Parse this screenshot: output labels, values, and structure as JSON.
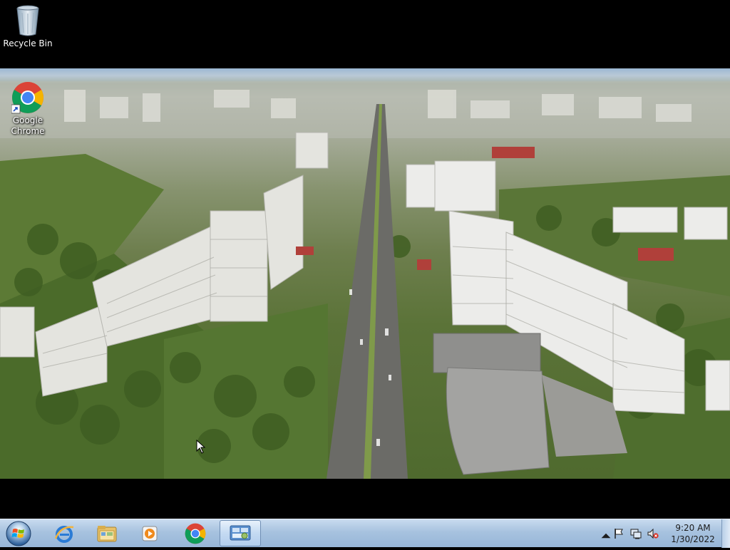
{
  "desktop": {
    "icons": [
      {
        "label": "Recycle Bin",
        "icon": "recycle-bin-icon"
      },
      {
        "label": "Google Chrome",
        "icon": "chrome-icon"
      }
    ],
    "wallpaper": "aerial city view"
  },
  "taskbar": {
    "start": {
      "icon": "windows-orb-icon"
    },
    "pinned": [
      {
        "icon": "internet-explorer-icon",
        "active": false
      },
      {
        "icon": "file-explorer-icon",
        "active": false
      },
      {
        "icon": "media-player-icon",
        "active": false
      },
      {
        "icon": "chrome-icon",
        "active": false
      },
      {
        "icon": "control-panel-icon",
        "active": true
      }
    ],
    "tray": {
      "icons": [
        "show-hidden-icons-arrow",
        "action-center-flag-icon",
        "network-icon",
        "volume-muted-icon"
      ],
      "time": "9:20 AM",
      "date": "1/30/2022"
    }
  },
  "colors": {
    "taskbar_top": "#c9dbef",
    "taskbar_bottom": "#97b6d8",
    "desktop_bg": "#000000"
  }
}
